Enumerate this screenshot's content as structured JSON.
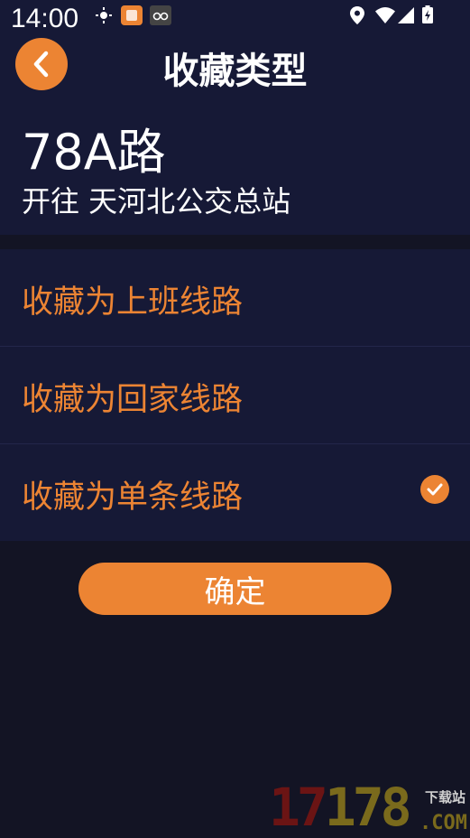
{
  "status_bar": {
    "time": "14:00"
  },
  "header": {
    "title": "收藏类型"
  },
  "route": {
    "name": "78A路",
    "direction": "开往 天河北公交总站"
  },
  "options": [
    {
      "label": "收藏为上班线路",
      "selected": false
    },
    {
      "label": "收藏为回家线路",
      "selected": false
    },
    {
      "label": "收藏为单条线路",
      "selected": true
    }
  ],
  "confirm_label": "确定",
  "watermark": {
    "number_red": "17",
    "number_yellow": "178",
    "site_text": "下载站",
    "domain": ".COM"
  },
  "colors": {
    "accent": "#ec8433",
    "panel": "#161936",
    "background": "#131424"
  }
}
